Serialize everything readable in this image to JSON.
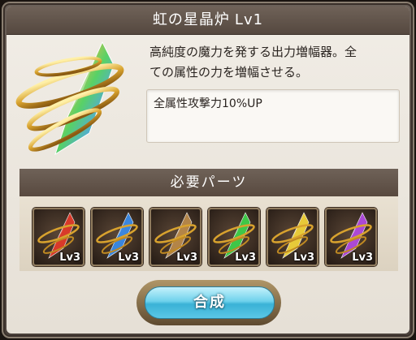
{
  "item": {
    "name": "虹の星晶炉",
    "level": "Lv1",
    "description_line1": "高純度の魔力を発する出力増幅器。全",
    "description_line2": "ての属性の力を増幅させる。",
    "effect": "全属性攻撃力10%UP"
  },
  "parts": {
    "header": "必要パーツ",
    "items": [
      {
        "level": "Lv3",
        "color": "#e03a2a"
      },
      {
        "level": "Lv3",
        "color": "#3a8be8"
      },
      {
        "level": "Lv3",
        "color": "#b9894a"
      },
      {
        "level": "Lv3",
        "color": "#3fcf4a"
      },
      {
        "level": "Lv3",
        "color": "#f0d23a"
      },
      {
        "level": "Lv3",
        "color": "#b14ae0"
      }
    ]
  },
  "actions": {
    "synthesize_label": "合成"
  }
}
